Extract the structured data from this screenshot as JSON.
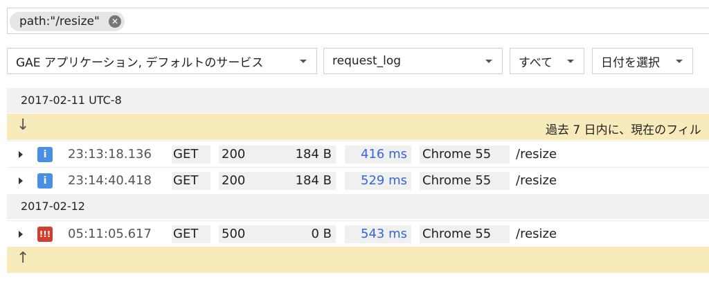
{
  "filter": {
    "chip_label": "path:\"/resize\"",
    "clear_icon": "close-circle-icon"
  },
  "selectors": {
    "resource": "GAE アプリケーション, デフォルトのサービス",
    "log_name": "request_log",
    "severity": "すべて",
    "date": "日付を選択"
  },
  "groups": [
    {
      "date": "2017-02-11 UTC-8"
    },
    {
      "date": "2017-02-12"
    }
  ],
  "banner_top": {
    "icon": "arrow-down-icon",
    "text": "過去 7 日内に、現在のフィル"
  },
  "banner_bottom": {
    "icon": "arrow-up-icon"
  },
  "rows": [
    {
      "severity": "info",
      "severity_glyph": "i",
      "timestamp": "23:13:18.136",
      "method": "GET",
      "status": "200",
      "size": "184 B",
      "latency": "416 ms",
      "user_agent": "Chrome 55",
      "path": "/resize"
    },
    {
      "severity": "info",
      "severity_glyph": "i",
      "timestamp": "23:14:40.418",
      "method": "GET",
      "status": "200",
      "size": "184 B",
      "latency": "529 ms",
      "user_agent": "Chrome 55",
      "path": "/resize"
    },
    {
      "severity": "error",
      "severity_glyph": "!!!",
      "timestamp": "05:11:05.617",
      "method": "GET",
      "status": "500",
      "size": "0 B",
      "latency": "543 ms",
      "user_agent": "Chrome 55",
      "path": "/resize"
    }
  ],
  "colors": {
    "latency": "#3367d6",
    "info": "#4a90e2",
    "error": "#d23f31",
    "banner": "#f8ebbb"
  }
}
